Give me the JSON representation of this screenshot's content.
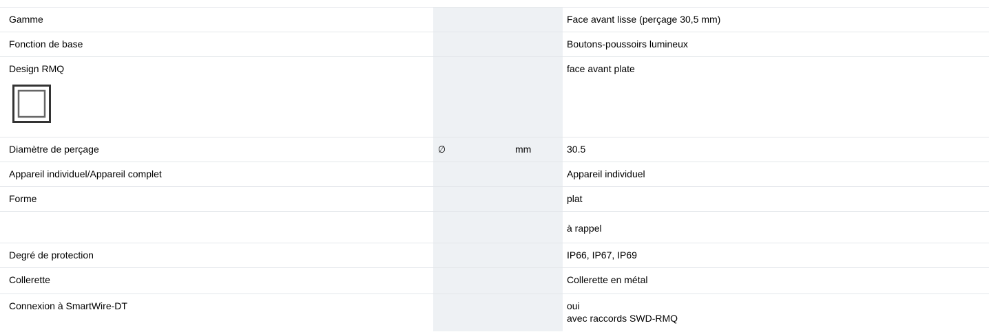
{
  "rows": [
    {
      "label": "Gamme",
      "symbol": "",
      "unit": "",
      "value": "Face avant lisse (perçage 30,5 mm)"
    },
    {
      "label": "Fonction de base",
      "symbol": "",
      "unit": "",
      "value": "Boutons-poussoirs lumineux"
    },
    {
      "label": "Design RMQ",
      "symbol": "",
      "unit": "",
      "value": "face avant plate",
      "icon": "flat-square-frame-icon"
    },
    {
      "label": "Diamètre de perçage",
      "symbol": "∅",
      "unit": "mm",
      "value": "30.5"
    },
    {
      "label": "Appareil individuel/Appareil complet",
      "symbol": "",
      "unit": "",
      "value": "Appareil individuel"
    },
    {
      "label": "Forme",
      "symbol": "",
      "unit": "",
      "value": "plat"
    },
    {
      "label": "",
      "symbol": "",
      "unit": "",
      "value": "à rappel"
    },
    {
      "label": "Degré de protection",
      "symbol": "",
      "unit": "",
      "value": "IP66, IP67, IP69"
    },
    {
      "label": "Collerette",
      "symbol": "",
      "unit": "",
      "value": "Collerette en métal"
    },
    {
      "label": "Connexion à SmartWire-DT",
      "symbol": "",
      "unit": "",
      "value": "oui",
      "value_line2": "avec raccords SWD-RMQ"
    }
  ],
  "colors": {
    "middle_column_bg": "#eef1f4",
    "row_divider": "#e3e6ea",
    "text": "#000000"
  }
}
